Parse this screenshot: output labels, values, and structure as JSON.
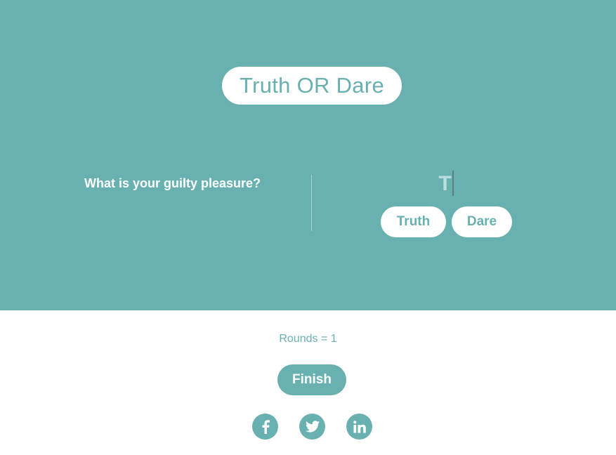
{
  "header": {
    "title": "Truth OR Dare"
  },
  "game": {
    "question": "What is your guilty pleasure?",
    "typed_text": "T",
    "truth_label": "Truth",
    "dare_label": "Dare"
  },
  "footer": {
    "rounds_text": "Rounds = 1",
    "finish_label": "Finish",
    "social": [
      {
        "icon": "facebook-icon"
      },
      {
        "icon": "twitter-icon"
      },
      {
        "icon": "linkedin-icon"
      }
    ]
  },
  "colors": {
    "accent": "#69b1b0",
    "background": "#ffffff",
    "typed_text": "#b8dedd"
  }
}
